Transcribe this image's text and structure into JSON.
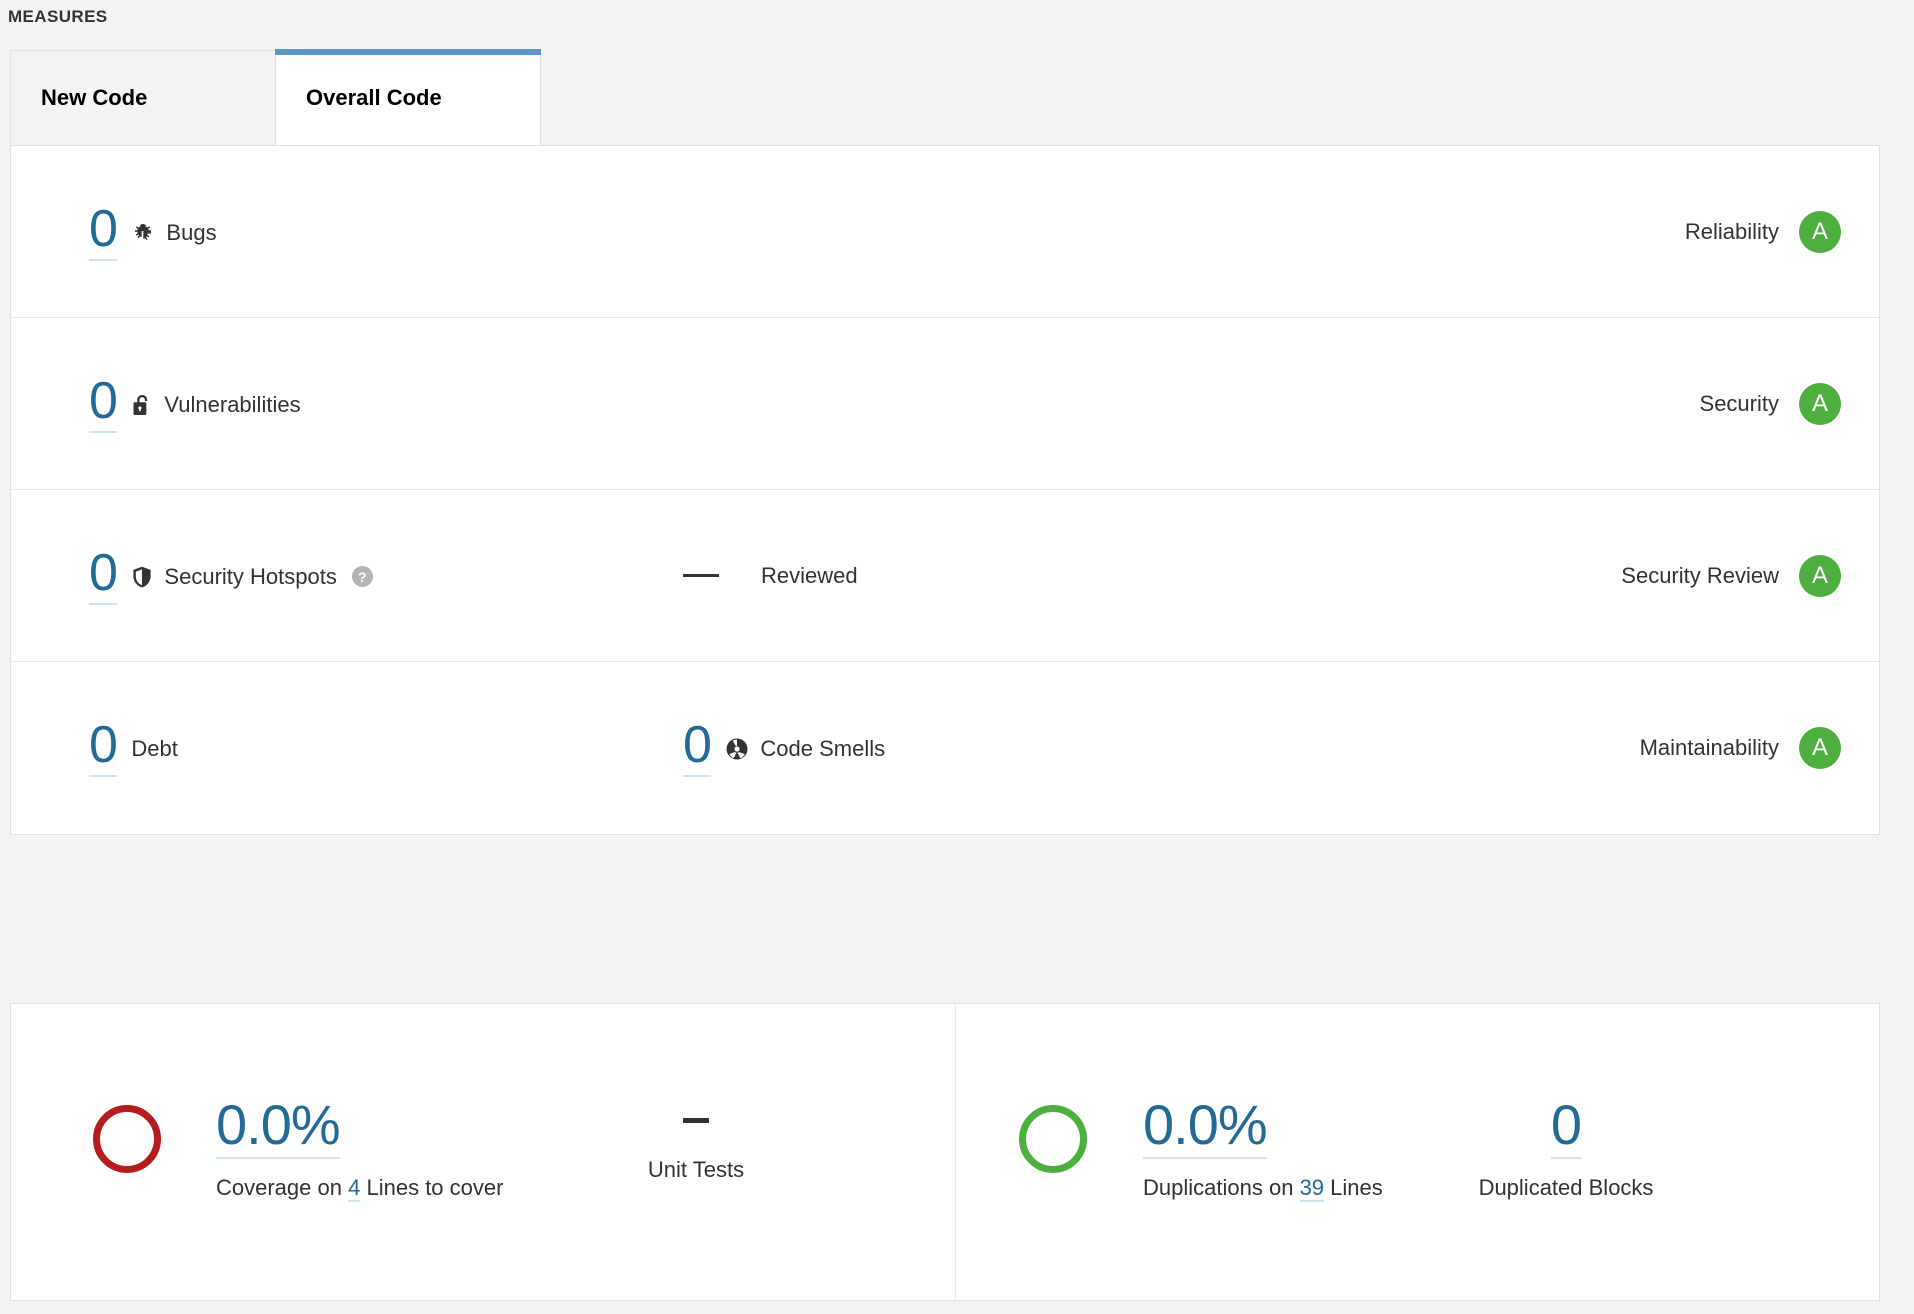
{
  "section": {
    "title": "MEASURES"
  },
  "tabs": [
    {
      "label": "New Code",
      "active": false
    },
    {
      "label": "Overall Code",
      "active": true
    }
  ],
  "colors": {
    "link": "#236a97",
    "link_underline": "#cfe3ef",
    "rating_a": "#4caf3e",
    "coverage_ring": "#b71c1c",
    "duplications_ring": "#4caf3e",
    "tab_active_bar": "#5c95c8"
  },
  "measures": [
    {
      "value": "0",
      "icon": "bug-icon",
      "label": "Bugs",
      "help": false,
      "secondary_value": null,
      "secondary_label": null,
      "secondary_icon": null,
      "rating_name": "Reliability",
      "rating_value": "A"
    },
    {
      "value": "0",
      "icon": "open-lock-icon",
      "label": "Vulnerabilities",
      "help": false,
      "secondary_value": null,
      "secondary_label": null,
      "secondary_icon": null,
      "rating_name": "Security",
      "rating_value": "A"
    },
    {
      "value": "0",
      "icon": "shield-icon",
      "label": "Security Hotspots",
      "help": true,
      "secondary_value": "—",
      "secondary_label": "Reviewed",
      "secondary_icon": null,
      "rating_name": "Security Review",
      "rating_value": "A"
    },
    {
      "value": "0",
      "icon": null,
      "label": "Debt",
      "help": false,
      "secondary_value": "0",
      "secondary_label": "Code Smells",
      "secondary_icon": "code-smell-icon",
      "rating_name": "Maintainability",
      "rating_value": "A"
    }
  ],
  "coverage": {
    "value": "0.0%",
    "caption_prefix": "Coverage on",
    "caption_link": "4",
    "caption_suffix": "Lines to cover",
    "unit_tests_value": "–",
    "unit_tests_label": "Unit Tests"
  },
  "duplications": {
    "value": "0.0%",
    "caption_prefix": "Duplications on",
    "caption_link": "39",
    "caption_suffix": "Lines",
    "blocks_value": "0",
    "blocks_label": "Duplicated Blocks"
  },
  "help_glyph": "?"
}
